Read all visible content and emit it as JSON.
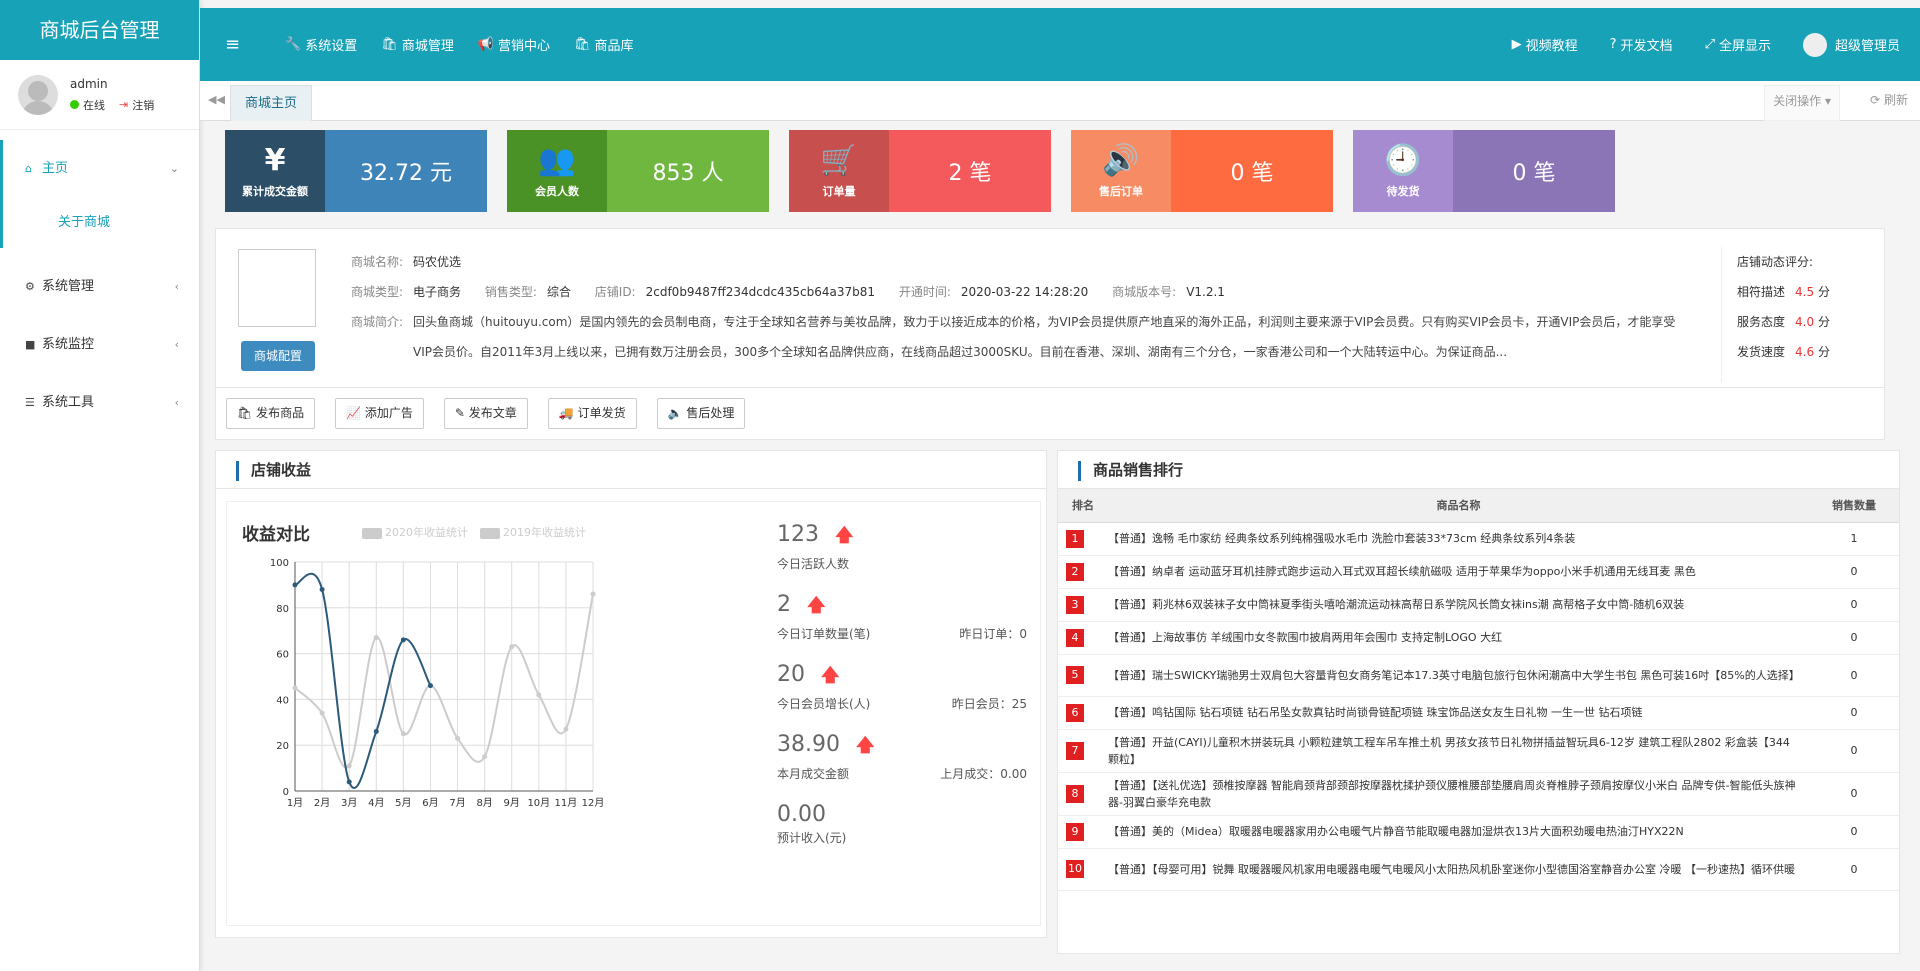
{
  "sidebar": {
    "logo": "商城后台管理",
    "user": {
      "name": "admin",
      "status": "在线",
      "logout": "注销"
    },
    "menu": [
      {
        "label": "主页",
        "icon": "home-icon"
      },
      {
        "label": "关于商城"
      },
      {
        "label": "系统管理",
        "icon": "gear-icon"
      },
      {
        "label": "系统监控",
        "icon": "video-icon"
      },
      {
        "label": "系统工具",
        "icon": "list-icon"
      }
    ]
  },
  "topbar": {
    "menu": [
      "系统设置",
      "商城管理",
      "营销中心",
      "商品库"
    ],
    "right": [
      "视频教程",
      "开发文档",
      "全屏显示"
    ],
    "user": "超级管理员"
  },
  "tabs": {
    "home": "商城主页",
    "ops": "关闭操作",
    "refresh": "刷新"
  },
  "stats": [
    {
      "glyph": "¥",
      "label": "累计成交金额",
      "value": "32.72 元"
    },
    {
      "glyph": "👥",
      "label": "会员人数",
      "value": "853 人"
    },
    {
      "glyph": "🛒",
      "label": "订单量",
      "value": "2 笔"
    },
    {
      "glyph": "🔊",
      "label": "售后订单",
      "value": "0 笔"
    },
    {
      "glyph": "🕘",
      "label": "待发货",
      "value": "0 笔"
    }
  ],
  "shop": {
    "config_btn": "商城配置",
    "name_label": "商城名称:",
    "name": "码农优选",
    "type_label": "商城类型:",
    "type": "电子商务",
    "sale_label": "销售类型:",
    "sale": "综合",
    "id_label": "店铺ID:",
    "id": "2cdf0b9487ff234dcdc435cb64a37b81",
    "open_label": "开通时间:",
    "open": "2020-03-22 14:28:20",
    "ver_label": "商城版本号:",
    "ver": "V1.2.1",
    "intro_label": "商城简介:",
    "intro": "回头鱼商城（huitouyu.com）是国内领先的会员制电商，专注于全球知名营养与美妆品牌，致力于以接近成本的价格，为VIP会员提供原产地直采的海外正品，利润则主要来源于VIP会员费。只有购买VIP会员卡，开通VIP会员后，才能享受VIP会员价。自2011年3月上线以来，已拥有数万注册会员，300多个全球知名品牌供应商，在线商品超过3000SKU。目前在香港、深圳、湖南有三个分仓，一家香港公司和一个大陆转运中心。为保证商品...",
    "rating_title": "店铺动态评分:",
    "ratings": [
      {
        "label": "相符描述",
        "value": "4.5",
        "unit": "分"
      },
      {
        "label": "服务态度",
        "value": "4.0",
        "unit": "分"
      },
      {
        "label": "发货速度",
        "value": "4.6",
        "unit": "分"
      }
    ],
    "actions": [
      "发布商品",
      "添加广告",
      "发布文章",
      "订单发货",
      "售后处理"
    ]
  },
  "income": {
    "title": "店铺收益",
    "kpis": [
      {
        "value": "123",
        "label": "今日活跃人数",
        "side": ""
      },
      {
        "value": "2",
        "label": "今日订单数量(笔)",
        "side": "昨日订单：0"
      },
      {
        "value": "20",
        "label": "今日会员增长(人)",
        "side": "昨日会员：25"
      },
      {
        "value": "38.90",
        "label": "本月成交金额",
        "side": "上月成交：0.00"
      },
      {
        "value": "0.00",
        "label": "预计收入(元)",
        "side": ""
      }
    ]
  },
  "chart_data": {
    "type": "line",
    "title": "收益对比",
    "categories": [
      "1月",
      "2月",
      "3月",
      "4月",
      "5月",
      "6月",
      "7月",
      "8月",
      "9月",
      "10月",
      "11月",
      "12月"
    ],
    "ylim": [
      0,
      100
    ],
    "yticks": [
      "0",
      "20",
      "40",
      "60",
      "80",
      "100"
    ],
    "series": [
      {
        "name": "2020年收益统计",
        "color": "#2c5a7a",
        "values": [
          90,
          88,
          4,
          26,
          66,
          46
        ]
      },
      {
        "name": "2019年收益统计",
        "color": "#cccccc",
        "values": [
          45,
          34,
          11,
          67,
          25,
          46,
          23,
          15,
          63,
          42,
          27,
          86
        ]
      }
    ],
    "legend_position": "top"
  },
  "ranking": {
    "title": "商品销售排行",
    "headers": [
      "排名",
      "商品名称",
      "销售数量"
    ],
    "rows": [
      {
        "rank": "1",
        "name": "【普通】逸畅 毛巾家纺 经典条纹系列纯棉强吸水毛巾 洗脸巾套装33*73cm 经典条纹系列4条装",
        "qty": "1"
      },
      {
        "rank": "2",
        "name": "【普通】纳卓者 运动蓝牙耳机挂脖式跑步运动入耳式双耳超长续航磁吸 适用于苹果华为oppo小米手机通用无线耳麦 黑色",
        "qty": "0"
      },
      {
        "rank": "3",
        "name": "【普通】莉兆林6双装袜子女中筒袜夏季街头嘻哈潮流运动袜高帮日系学院风长筒女袜ins潮 高帮格子女中筒-随机6双装",
        "qty": "0"
      },
      {
        "rank": "4",
        "name": "【普通】上海故事仿 羊绒围巾女冬款围巾披肩两用年会围巾 支持定制LOGO 大红",
        "qty": "0"
      },
      {
        "rank": "5",
        "name": "【普通】瑞士SWICKY瑞驰男士双肩包大容量背包女商务笔记本17.3英寸电脑包旅行包休闲潮高中大学生书包 黑色可装16吋【85%的人选择】",
        "qty": "0"
      },
      {
        "rank": "6",
        "name": "【普通】鸣钻国际 钻石项链 钻石吊坠女款真钻时尚锁骨链配项链 珠宝饰品送女友生日礼物 一生一世 钻石项链",
        "qty": "0"
      },
      {
        "rank": "7",
        "name": "【普通】开益(CAYI)儿童积木拼装玩具 小颗粒建筑工程车吊车推土机 男孩女孩节日礼物拼插益智玩具6-12岁 建筑工程队2802 彩盒装【344颗粒】",
        "qty": "0"
      },
      {
        "rank": "8",
        "name": "【普通】【送礼优选】颈椎按摩器 智能肩颈背部颈部按摩器枕揉护颈仪腰椎腰部垫腰肩周炎脊椎脖子颈肩按摩仪小米白 品牌专供-智能低头族神器-羽翼白豪华充电款",
        "qty": "0"
      },
      {
        "rank": "9",
        "name": "【普通】美的（Midea）取暖器电暖器家用办公电暖气片静音节能取暖电器加湿烘衣13片大面积劲暖电热油汀HYX22N",
        "qty": "0"
      },
      {
        "rank": "10",
        "name": "【普通】【母婴可用】锐舞 取暖器暖风机家用电暖器电暖气电暖风小太阳热风机卧室迷你小型德国浴室静音办公室 冷暖 【一秒速热】循环供暖",
        "qty": "0"
      }
    ]
  }
}
